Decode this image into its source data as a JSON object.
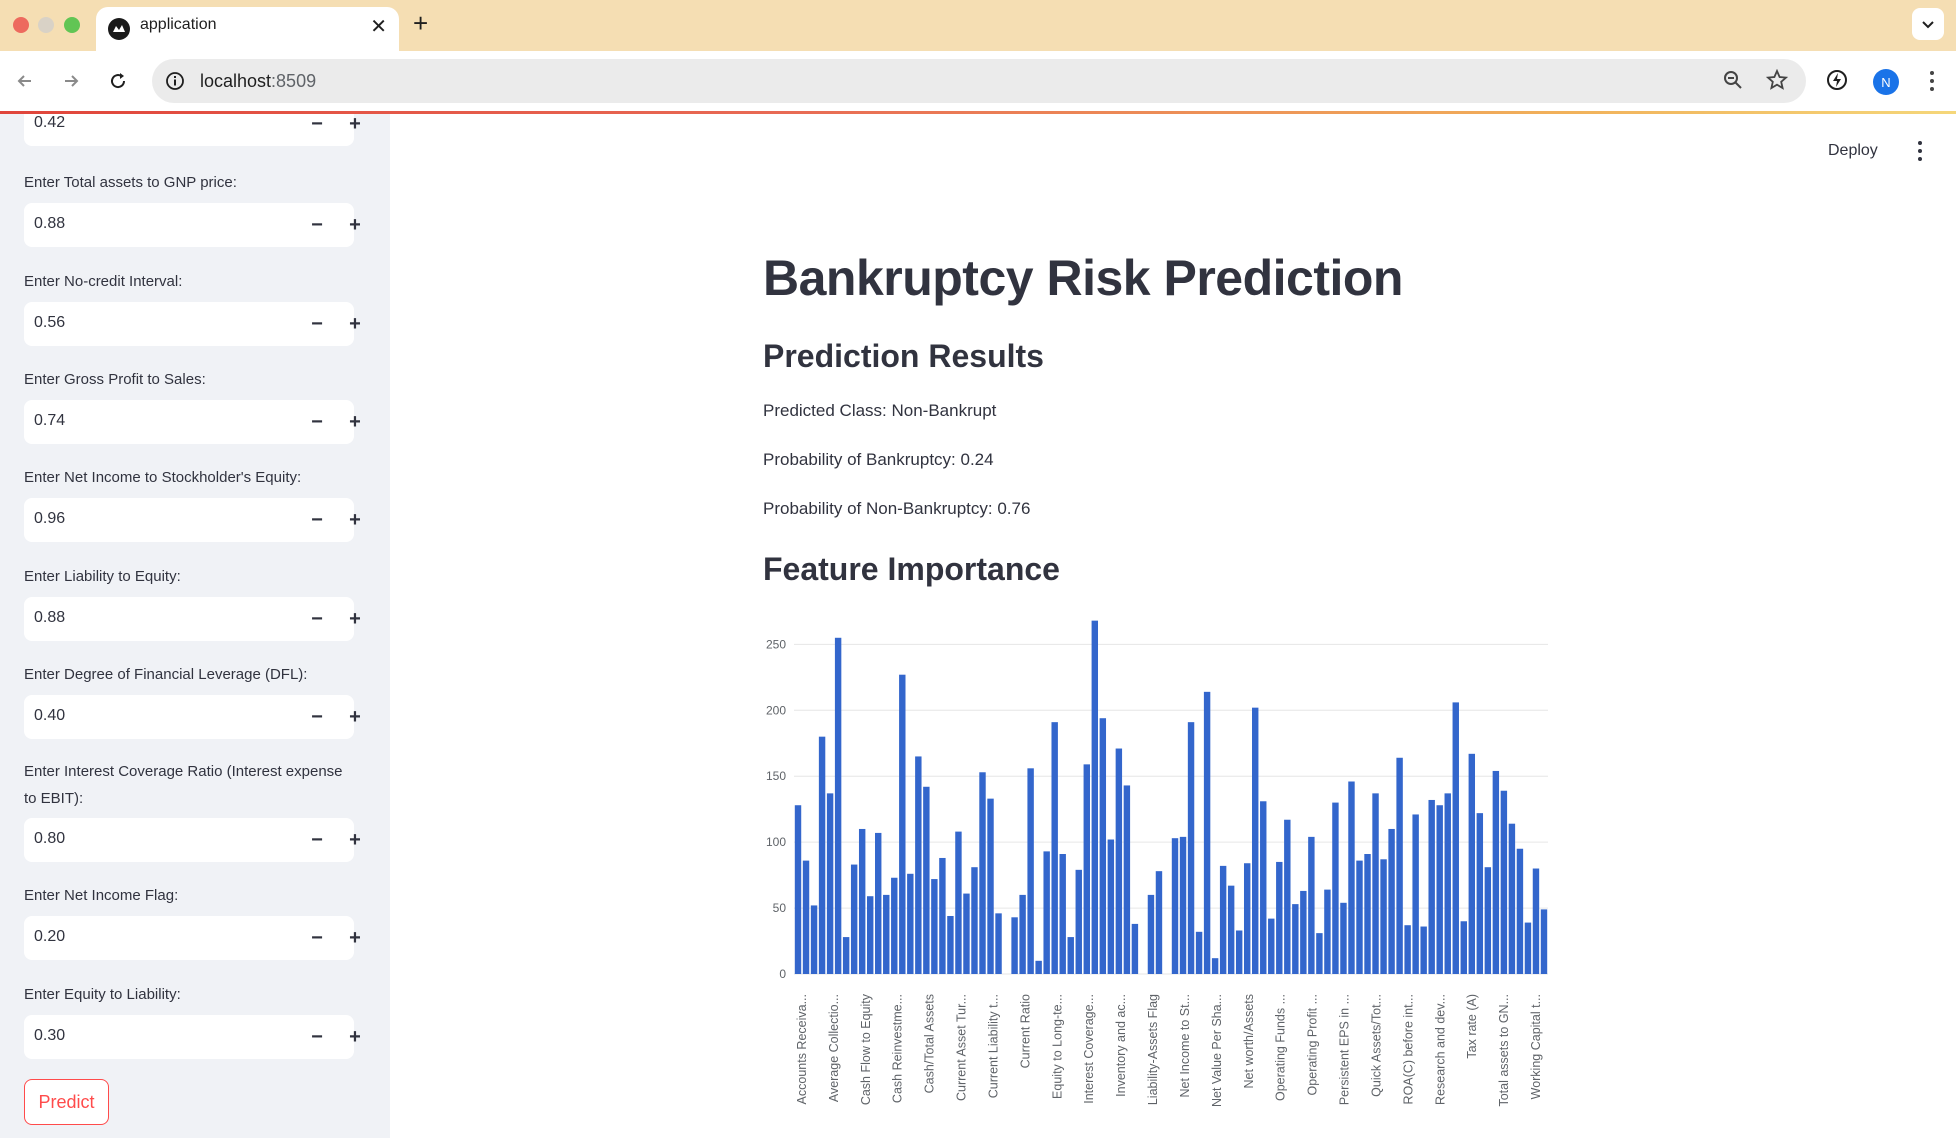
{
  "browser": {
    "tab_title": "application",
    "url_host": "localhost",
    "url_port": ":8509",
    "profile_initial": "N"
  },
  "sidebar": {
    "top_partial_value": "0.42",
    "fields": [
      {
        "label": "Enter Total assets to GNP price:",
        "value": "0.88"
      },
      {
        "label": "Enter No-credit Interval:",
        "value": "0.56"
      },
      {
        "label": "Enter Gross Profit to Sales:",
        "value": "0.74"
      },
      {
        "label": "Enter Net Income to Stockholder's Equity:",
        "value": "0.96"
      },
      {
        "label": "Enter Liability to Equity:",
        "value": "0.88"
      },
      {
        "label": "Enter Degree of Financial Leverage (DFL):",
        "value": "0.40"
      },
      {
        "label": "Enter Interest Coverage Ratio (Interest expense to EBIT):",
        "value": "0.80"
      },
      {
        "label": "Enter Net Income Flag:",
        "value": "0.20"
      },
      {
        "label": "Enter Equity to Liability:",
        "value": "0.30"
      }
    ],
    "predict_label": "Predict"
  },
  "header": {
    "deploy_label": "Deploy"
  },
  "main": {
    "title": "Bankruptcy Risk Prediction",
    "results_heading": "Prediction Results",
    "predicted_class": "Predicted Class: Non-Bankrupt",
    "prob_bankrupt": "Probability of Bankruptcy: 0.24",
    "prob_non_bankrupt": "Probability of Non-Bankruptcy: 0.76",
    "feature_heading": "Feature Importance"
  },
  "colors": {
    "bar": "#3366cc",
    "accent": "#ff4b4b"
  },
  "chart_data": {
    "type": "bar",
    "title": "",
    "xlabel": "",
    "ylabel": "",
    "ylim": [
      0,
      270
    ],
    "yticks": [
      0,
      50,
      100,
      150,
      200,
      250
    ],
    "grid": true,
    "legend": "none",
    "tick_labels": [
      "Accounts Receiva...",
      "Average Collectio...",
      "Cash Flow to Equity",
      "Cash Reinvestme...",
      "Cash/Total Assets",
      "Current Asset Tur...",
      "Current Liability t...",
      "Current Ratio",
      "Equity to Long-te...",
      "Interest Coverage...",
      "Inventory and ac...",
      "Liability-Assets Flag",
      "Net Income to St...",
      "Net Value Per Sha...",
      "Net worth/Assets",
      "Operating Funds ...",
      "Operating Profit ...",
      "Persistent EPS in ...",
      "Quick Assets/Tot...",
      "ROA(C) before int...",
      "Research and dev...",
      "Tax rate (A)",
      "Total assets to GN...",
      "Working Capital t..."
    ],
    "values": [
      128,
      86,
      52,
      180,
      137,
      255,
      28,
      83,
      110,
      59,
      107,
      60,
      73,
      227,
      76,
      165,
      142,
      72,
      88,
      44,
      108,
      61,
      81,
      153,
      133,
      46,
      0,
      43,
      60,
      156,
      10,
      93,
      191,
      91,
      28,
      79,
      159,
      268,
      194,
      102,
      171,
      143,
      38,
      0,
      60,
      78,
      0,
      103,
      104,
      191,
      32,
      214,
      12,
      82,
      67,
      33,
      84,
      202,
      131,
      42,
      85,
      117,
      53,
      63,
      104,
      31,
      64,
      130,
      54,
      146,
      86,
      91,
      137,
      87,
      110,
      164,
      37,
      121,
      36,
      132,
      128,
      137,
      206,
      40,
      167,
      122,
      81,
      154,
      139,
      114,
      95,
      39,
      80,
      49
    ]
  }
}
